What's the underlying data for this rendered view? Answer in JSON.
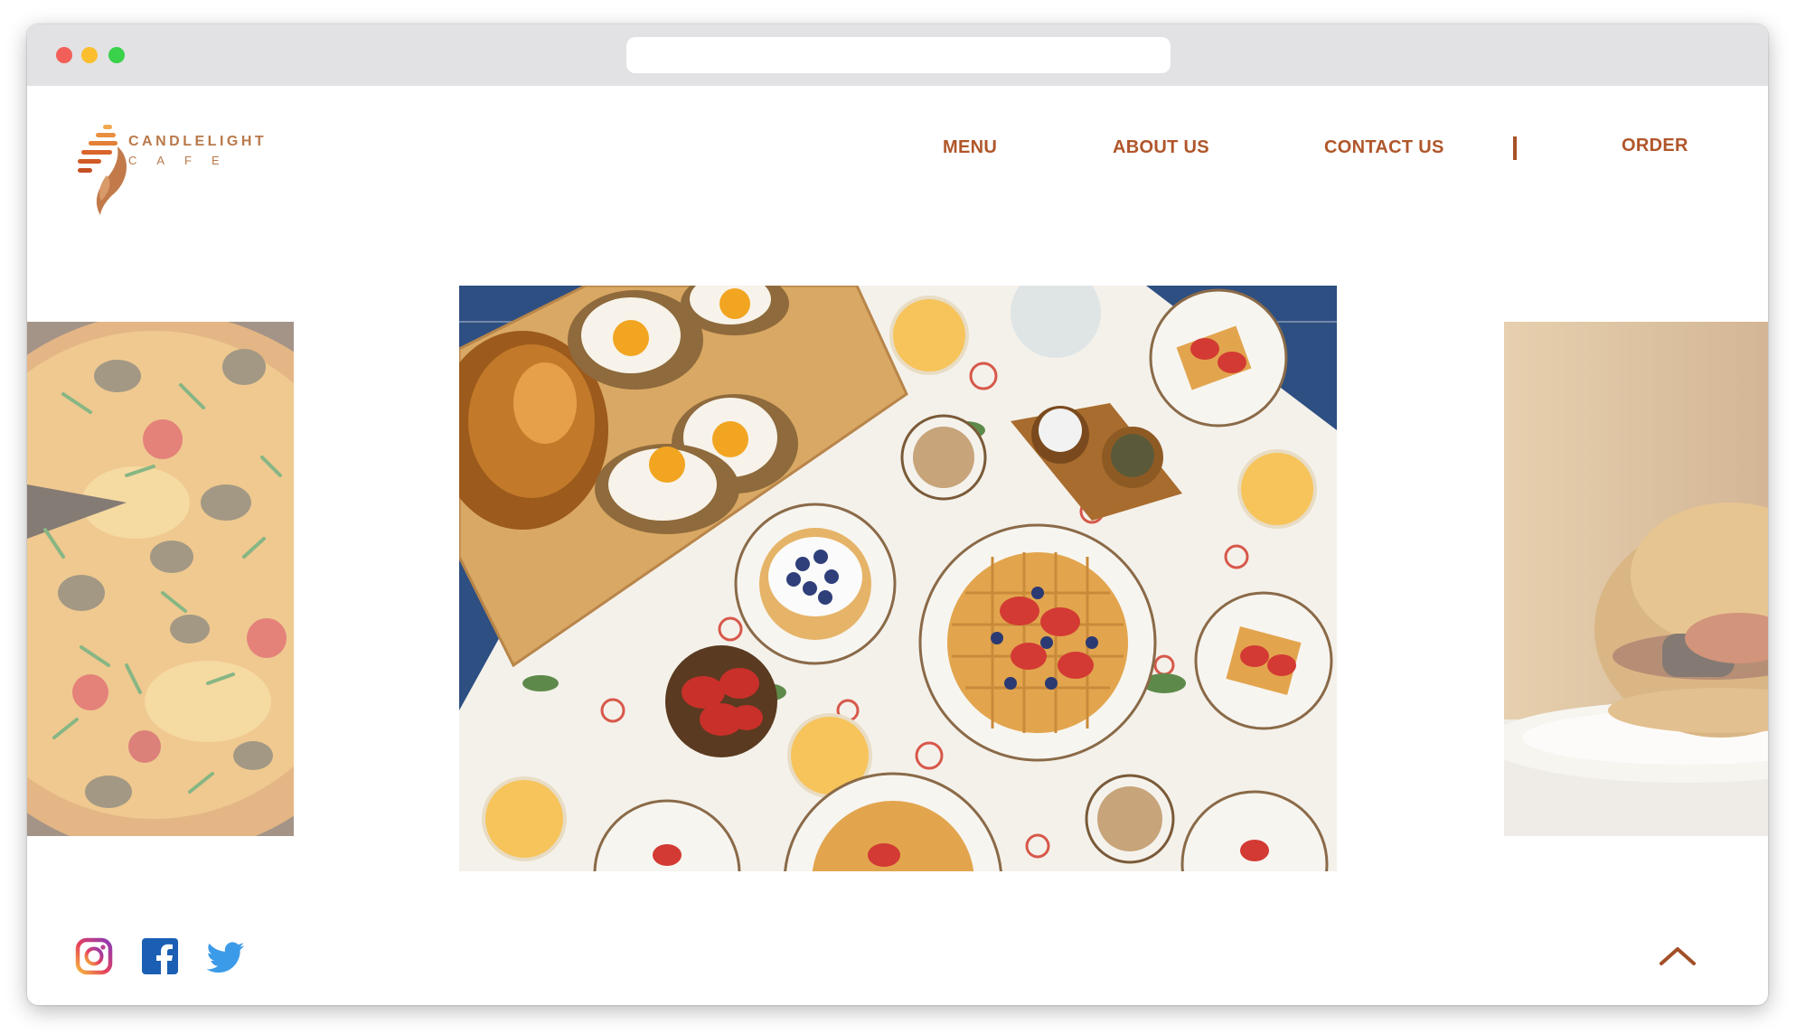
{
  "window": {
    "url": ""
  },
  "brand": {
    "name_line1": "CANDLELIGHT",
    "name_line2": "CAFE"
  },
  "nav": {
    "menu": "MENU",
    "about": "ABOUT US",
    "contact": "CONTACT US",
    "order": "ORDER"
  },
  "carousel": {
    "slides": [
      {
        "icon": "pizza-photo"
      },
      {
        "icon": "breakfast-table-photo"
      },
      {
        "icon": "burger-photo"
      }
    ]
  },
  "footer": {
    "social": [
      {
        "icon": "instagram-icon"
      },
      {
        "icon": "facebook-icon"
      },
      {
        "icon": "twitter-icon"
      }
    ],
    "scroll_top_icon": "chevron-up-icon"
  },
  "colors": {
    "accent": "#b0562a",
    "logo": "#c47a3e",
    "titlebar": "#e2e2e4"
  }
}
